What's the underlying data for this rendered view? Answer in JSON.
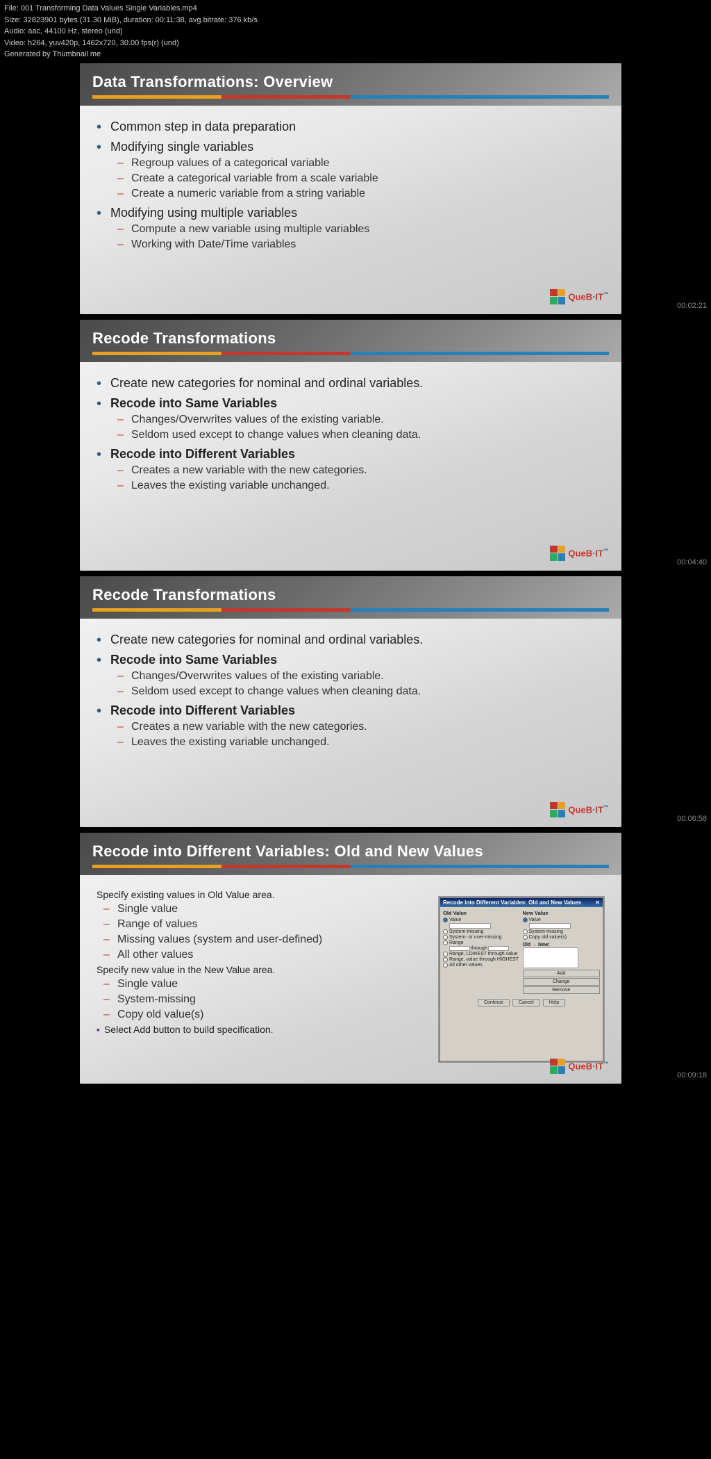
{
  "file_info": {
    "line1": "File: 001 Transforming Data Values Single Variables.mp4",
    "line2": "Size: 32823901 bytes (31.30 MiB), duration: 00:11:38, avg.bitrate: 376 kb/s",
    "line3": "Audio: aac, 44100 Hz, stereo (und)",
    "line4": "Video: h264, yuv420p, 1462x720, 30.00 fps(r) (und)",
    "line5": "Generated by Thumbnail me"
  },
  "slides": [
    {
      "id": "slide1",
      "header": "Data Transformations: Overview",
      "timestamp": "00:02:21",
      "bullets": [
        {
          "text": "Common step in data preparation",
          "bold": false,
          "subitems": []
        },
        {
          "text": "Modifying single variables",
          "bold": false,
          "subitems": [
            "Regroup values of a categorical variable",
            "Create a categorical variable from a scale variable",
            "Create a numeric variable from a string variable"
          ]
        },
        {
          "text": "Modifying using multiple variables",
          "bold": false,
          "subitems": [
            "Compute a new variable using multiple variables",
            "Working with Date/Time variables"
          ]
        }
      ]
    },
    {
      "id": "slide2",
      "header": "Recode Transformations",
      "timestamp": "00:04:40",
      "bullets": [
        {
          "text": "Create new categories for nominal and ordinal variables.",
          "bold": false,
          "subitems": []
        },
        {
          "text": "Recode into Same Variables",
          "bold": true,
          "subitems": [
            "Changes/Overwrites values of the existing variable.",
            "Seldom used except to change values when cleaning data."
          ]
        },
        {
          "text": "Recode into Different Variables",
          "bold": true,
          "subitems": [
            "Creates a new variable with the new categories.",
            "Leaves the existing variable unchanged."
          ]
        }
      ]
    },
    {
      "id": "slide3",
      "header": "Recode Transformations",
      "timestamp": "00:06:58",
      "bullets": [
        {
          "text": "Create new categories for nominal and ordinal variables.",
          "bold": false,
          "subitems": []
        },
        {
          "text": "Recode into Same Variables",
          "bold": true,
          "subitems": [
            "Changes/Overwrites values of the existing variable.",
            "Seldom used except to change values when cleaning data."
          ]
        },
        {
          "text": "Recode into Different Variables",
          "bold": true,
          "subitems": [
            "Creates a new variable with the new categories.",
            "Leaves the existing variable unchanged."
          ]
        }
      ]
    },
    {
      "id": "slide4",
      "header": "Recode into Different Variables: Old and New Values",
      "timestamp": "00:09:18",
      "bullets": [
        {
          "text": "Specify existing values in Old Value area.",
          "bold": false,
          "subitems": [
            "Single value",
            "Range of values",
            "Missing values (system and user-defined)",
            "All other values"
          ]
        },
        {
          "text": "Specify new value in the New Value area.",
          "bold": false,
          "subitems": [
            "Single value",
            "System-missing",
            "Copy old value(s)"
          ]
        },
        {
          "text": "Select Add button to build specification.",
          "bold": false,
          "square_bullet": true,
          "subitems": []
        }
      ],
      "dialog": {
        "title": "Recode into Different Variables: Old and New Values",
        "old_value_label": "Old Value",
        "new_value_label": "New Value",
        "old_options": [
          "Value",
          "System-missing",
          "System- or user-missing",
          "Range",
          "Range, LOWEST through value",
          "Range, value through HIGHEST",
          "All other values"
        ],
        "new_options": [
          "Value",
          "System-missing",
          "Copy old value(s)"
        ],
        "buttons": [
          "Continue",
          "Cancel",
          "Help"
        ]
      }
    }
  ],
  "logo": {
    "text": "Que",
    "bold": "B·IT"
  }
}
